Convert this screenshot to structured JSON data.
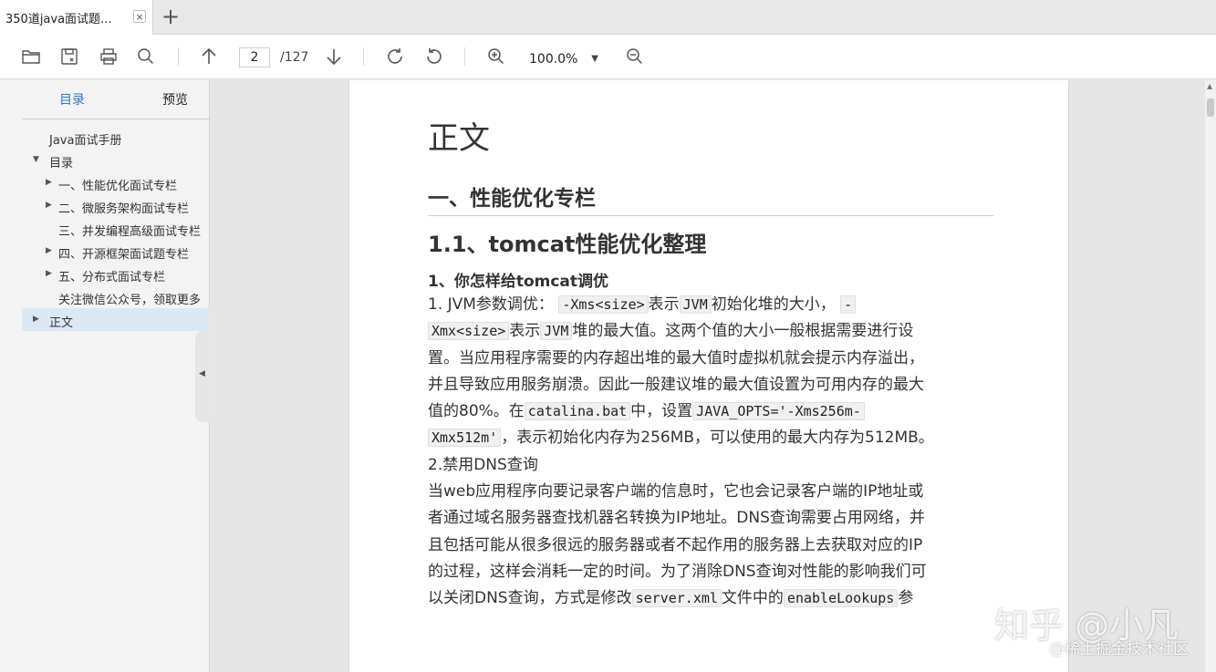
{
  "tab": {
    "title": "350道java面试题...",
    "close": "×",
    "new": "+"
  },
  "toolbar": {
    "current_page": "2",
    "total_pages": "/127",
    "zoom": "100.0%",
    "zoom_arrow": "▼"
  },
  "sidebar": {
    "tabs": [
      {
        "label": "目录"
      },
      {
        "label": "预览"
      }
    ],
    "outline": [
      {
        "label": "Java面试手册",
        "level": 0,
        "arrow": ""
      },
      {
        "label": "目录",
        "level": 0,
        "arrow": "▼"
      },
      {
        "label": "一、性能优化面试专栏",
        "level": 1,
        "arrow": "▶"
      },
      {
        "label": "二、微服务架构面试专栏",
        "level": 1,
        "arrow": "▶"
      },
      {
        "label": "三、并发编程高级面试专栏",
        "level": 1,
        "arrow": ""
      },
      {
        "label": "四、开源框架面试题专栏",
        "level": 1,
        "arrow": "▶"
      },
      {
        "label": "五、分布式面试专栏",
        "level": 1,
        "arrow": "▶"
      },
      {
        "label": "关注微信公众号，领取更多",
        "level": 1,
        "arrow": ""
      },
      {
        "label": "正文",
        "level": 0,
        "arrow": "▶"
      }
    ],
    "handle": "◀"
  },
  "document": {
    "body_heading": "正文",
    "h1": "一、性能优化专栏",
    "h2": "1.1、tomcat性能优化整理",
    "h3": "1、你怎样给tomcat调优",
    "p1": {
      "t1": "1. JVM参数调优：",
      "c1": "-Xms<size>",
      "t2": "表示",
      "c2": "JVM",
      "t3": "初始化堆的大小，",
      "c3a": "-",
      "c3b": "Xmx<size>",
      "t4": "表示",
      "c4": "JVM",
      "t5": "堆的最大值。这两个值的大小一般根据需要进行设",
      "t6": "置。当应用程序需要的内存超出堆的最大值时虚拟机就会提示内存溢出，",
      "t7": "并且导致应用服务崩溃。因此一般建议堆的最大值设置为可用内存的最大",
      "t8": "值的80%。在",
      "c5": "catalina.bat",
      "t9": "中，设置",
      "c6a": "JAVA_OPTS='-Xms256m-",
      "c6b": "Xmx512m'",
      "t10": "，表示初始化内存为256MB，可以使用的最大内存为512MB。"
    },
    "p2_title": "2.禁用DNS查询",
    "p2": {
      "l1": "当web应用程序向要记录客户端的信息时，它也会记录客户端的IP地址或",
      "l2": "者通过域名服务器查找机器名转换为IP地址。DNS查询需要占用网络，并",
      "l3": "且包括可能从很多很远的服务器或者不起作用的服务器上去获取对应的IP",
      "l4": "的过程，这样会消耗一定的时间。为了消除DNS查询对性能的影响我们可",
      "l5a": "以关闭DNS查询，方式是修改",
      "c1": "server.xml",
      "l5b": "文件中的",
      "c2": "enableLookups",
      "l5c": "参"
    }
  },
  "watermark": {
    "main": "知乎 @小凡",
    "sub": "@稀土掘金技术社区"
  },
  "scrollbar": {
    "up": "▲"
  }
}
